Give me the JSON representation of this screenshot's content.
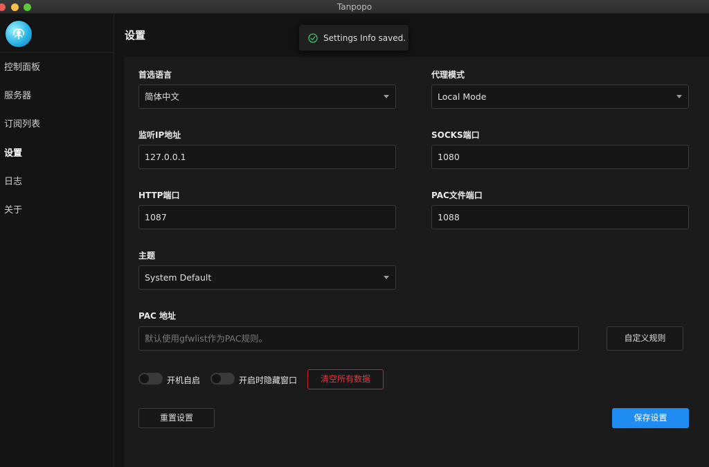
{
  "window": {
    "title": "Tanpopo"
  },
  "sidebar": {
    "items": [
      {
        "label": "控制面板"
      },
      {
        "label": "服务器"
      },
      {
        "label": "订阅列表"
      },
      {
        "label": "设置"
      },
      {
        "label": "日志"
      },
      {
        "label": "关于"
      }
    ],
    "active": "设置"
  },
  "page": {
    "title": "设置"
  },
  "toast": {
    "text": "Settings Info saved.",
    "icon": "check-circle-icon"
  },
  "settings": {
    "language": {
      "label": "首选语言",
      "value": "简体中文"
    },
    "proxy_mode": {
      "label": "代理模式",
      "value": "Local Mode"
    },
    "listen_ip": {
      "label": "监听IP地址",
      "value": "127.0.0.1"
    },
    "socks_port": {
      "label": "SOCKS端口",
      "value": "1080"
    },
    "http_port": {
      "label": "HTTP端口",
      "value": "1087"
    },
    "pac_port": {
      "label": "PAC文件端口",
      "value": "1088"
    },
    "theme": {
      "label": "主题",
      "value": "System Default"
    },
    "pac_address": {
      "label": "PAC 地址",
      "placeholder": "默认使用gfwlist作为PAC规则。"
    },
    "custom_rules_button": "自定义规则",
    "autostart": {
      "label": "开机自启",
      "enabled": false
    },
    "hide_window": {
      "label": "开启时隐藏窗口",
      "enabled": false
    },
    "clear_data_button": "清空所有数据",
    "reset_button": "重置设置",
    "save_button": "保存设置"
  },
  "colors": {
    "accent": "#1f8cf2",
    "danger": "#e0393f",
    "success": "#3cc36b"
  }
}
